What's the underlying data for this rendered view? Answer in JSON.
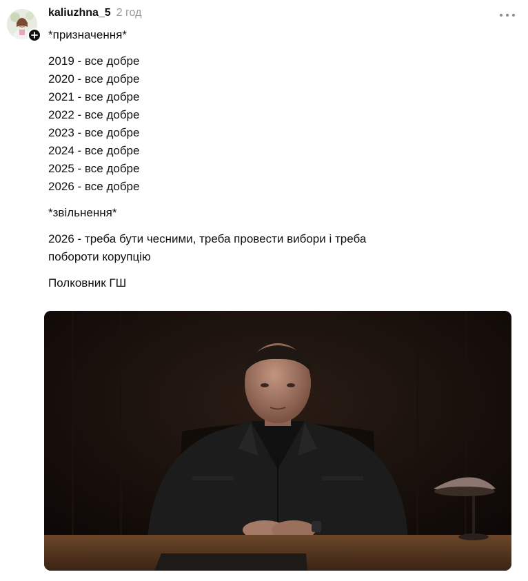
{
  "post": {
    "author": {
      "username": "kaliuzhna_5",
      "avatar_icon": "avatar-photo",
      "follow_icon": "plus-icon"
    },
    "timestamp": "2 год",
    "more_icon": "more-horizontal-icon",
    "text": {
      "intro": "*призначення*",
      "years": [
        "2019 - все добре",
        "2020 - все добре",
        "2021 - все добре",
        "2022 - все добре",
        "2023 - все добре",
        "2024 - все добре",
        "2025 - все добре",
        "2026 - все добре"
      ],
      "dismissal": "*звільнення*",
      "statement_line1": "2026 - треба бути чесними, треба провести вибори і треба",
      "statement_line2": "побороти корупцію",
      "signature": "Полковник ГШ"
    },
    "media": {
      "type": "video-frame",
      "colors": {
        "background": "#140d0a",
        "desk": "#5a3a22",
        "jacket": "#1c1c1c"
      }
    }
  }
}
